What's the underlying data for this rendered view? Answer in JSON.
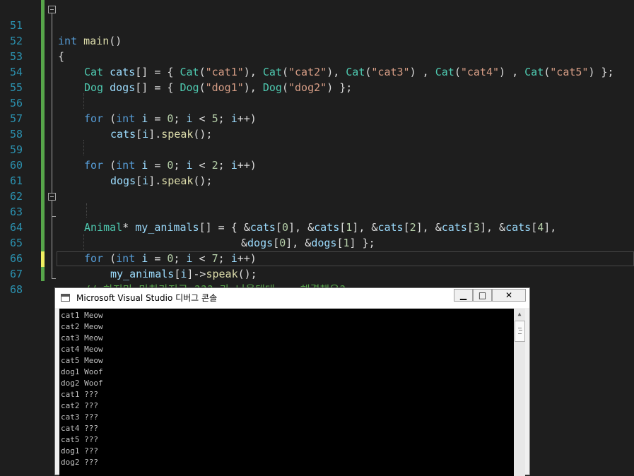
{
  "editor": {
    "lines": [
      {
        "num": "51"
      },
      {
        "num": "52"
      },
      {
        "num": "53"
      },
      {
        "num": "54"
      },
      {
        "num": "55"
      },
      {
        "num": "56"
      },
      {
        "num": "57"
      },
      {
        "num": "58"
      },
      {
        "num": "59"
      },
      {
        "num": "60"
      },
      {
        "num": "61"
      },
      {
        "num": "62"
      },
      {
        "num": "63"
      },
      {
        "num": "64"
      },
      {
        "num": "65"
      },
      {
        "num": "66"
      },
      {
        "num": "67"
      },
      {
        "num": "68"
      }
    ],
    "code": {
      "l51": {
        "t1": "int",
        "t2": " ",
        "t3": "main",
        "t4": "()"
      },
      "l52": {
        "t1": "{"
      },
      "l53": {
        "t1": "Cat",
        "t2": " ",
        "t3": "cats",
        "t4": "[] = { ",
        "t5": "Cat",
        "t6": "(",
        "t7": "\"cat1\"",
        "t8": "), ",
        "t9": "Cat",
        "t10": "(",
        "t11": "\"cat2\"",
        "t12": "), ",
        "t13": "Cat",
        "t14": "(",
        "t15": "\"cat3\"",
        "t16": ") , ",
        "t17": "Cat",
        "t18": "(",
        "t19": "\"cat4\"",
        "t20": ") , ",
        "t21": "Cat",
        "t22": "(",
        "t23": "\"cat5\"",
        "t24": ") };"
      },
      "l54": {
        "t1": "Dog",
        "t2": " ",
        "t3": "dogs",
        "t4": "[] = { ",
        "t5": "Dog",
        "t6": "(",
        "t7": "\"dog1\"",
        "t8": "), ",
        "t9": "Dog",
        "t10": "(",
        "t11": "\"dog2\"",
        "t12": ") };"
      },
      "l56": {
        "t1": "for",
        "t2": " (",
        "t3": "int",
        "t4": " ",
        "t5": "i",
        "t6": " = ",
        "t7": "0",
        "t8": "; ",
        "t9": "i",
        "t10": " < ",
        "t11": "5",
        "t12": "; ",
        "t13": "i",
        "t14": "++)"
      },
      "l57": {
        "t1": "cats",
        "t2": "[",
        "t3": "i",
        "t4": "].",
        "t5": "speak",
        "t6": "();"
      },
      "l59": {
        "t1": "for",
        "t2": " (",
        "t3": "int",
        "t4": " ",
        "t5": "i",
        "t6": " = ",
        "t7": "0",
        "t8": "; ",
        "t9": "i",
        "t10": " < ",
        "t11": "2",
        "t12": "; ",
        "t13": "i",
        "t14": "++)"
      },
      "l60": {
        "t1": "dogs",
        "t2": "[",
        "t3": "i",
        "t4": "].",
        "t5": "speak",
        "t6": "();"
      },
      "l63": {
        "t1": "Animal",
        "t2": "* ",
        "t3": "my_animals",
        "t4": "[] = { &",
        "t5": "cats",
        "t6": "[",
        "t7": "0",
        "t8": "], &",
        "t9": "cats",
        "t10": "[",
        "t11": "1",
        "t12": "], &",
        "t13": "cats",
        "t14": "[",
        "t15": "2",
        "t16": "], &",
        "t17": "cats",
        "t18": "[",
        "t19": "3",
        "t20": "], &",
        "t21": "cats",
        "t22": "[",
        "t23": "4",
        "t24": "],"
      },
      "l64": {
        "t1": "&",
        "t2": "dogs",
        "t3": "[",
        "t4": "0",
        "t5": "], &",
        "t6": "dogs",
        "t7": "[",
        "t8": "1",
        "t9": "] };"
      },
      "l65": {
        "t1": "for",
        "t2": " (",
        "t3": "int",
        "t4": " ",
        "t5": "i",
        "t6": " = ",
        "t7": "0",
        "t8": "; ",
        "t9": "i",
        "t10": " < ",
        "t11": "7",
        "t12": "; ",
        "t13": "i",
        "t14": "++)"
      },
      "l66": {
        "t1": "my_animals",
        "t2": "[",
        "t3": "i",
        "t4": "]->",
        "t5": "speak",
        "t6": "();"
      },
      "l67": {
        "t1": "// 하지만 마찬가지로 ??? 가 나올텐데... 해결책은?"
      },
      "l68": {
        "t1": "}"
      }
    }
  },
  "console": {
    "title": "Microsoft Visual Studio 디버그 콘솔",
    "buttons": {
      "minimize": "▁",
      "maximize": "□",
      "close": "✕"
    },
    "scroll_up": "▲",
    "output": [
      "cat1 Meow",
      "cat2 Meow",
      "cat3 Meow",
      "cat4 Meow",
      "cat5 Meow",
      "dog1 Woof",
      "dog2 Woof",
      "cat1 ???",
      "cat2 ???",
      "cat3 ???",
      "cat4 ???",
      "cat5 ???",
      "dog1 ???",
      "dog2 ???"
    ]
  },
  "colors": {
    "background": "#1e1e1e",
    "line_number": "#2b91af",
    "keyword": "#569cd6",
    "type": "#4ec9b0",
    "string": "#d69d85",
    "comment": "#57a64a",
    "change_saved": "#57a64a",
    "change_unsaved": "#efef60"
  }
}
